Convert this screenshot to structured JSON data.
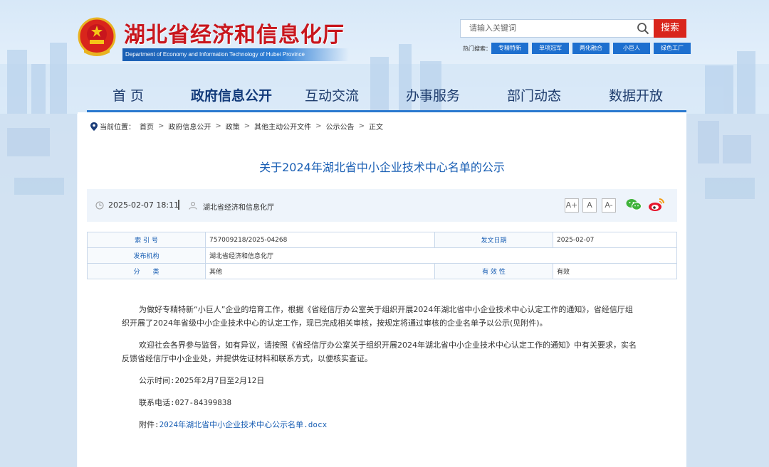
{
  "header": {
    "site_title": "湖北省经济和信息化厅",
    "site_subtitle": "Department of Economy and Information Technology of Hubei Province",
    "search_placeholder": "请输入关键词",
    "search_button": "搜索",
    "hot_label": "热门搜索：",
    "hot_tags": [
      "专精特新",
      "单项冠军",
      "两化融合",
      "小巨人",
      "绿色工厂"
    ]
  },
  "nav": {
    "items": [
      "首 页",
      "政府信息公开",
      "互动交流",
      "办事服务",
      "部门动态",
      "数据开放"
    ],
    "active_index": 1
  },
  "breadcrumb": {
    "label": "当前位置：",
    "items": [
      "首页",
      "政府信息公开",
      "政策",
      "其他主动公开文件",
      "公示公告",
      "正文"
    ],
    "separator": ">"
  },
  "article": {
    "title": "关于2024年湖北省中小企业技术中心名单的公示",
    "date": "2025-02-07 18:11",
    "source": "湖北省经济和信息化厅",
    "font_sizes": [
      "A+",
      "A",
      "A-"
    ]
  },
  "meta_table": {
    "index_label": "索 引 号",
    "index_value": "757009218/2025-04268",
    "date_label": "发文日期",
    "date_value": "2025-02-07",
    "org_label": "发布机构",
    "org_value": "湖北省经济和信息化厅",
    "category_label": "分　　类",
    "category_value": "其他",
    "validity_label": "有 效 性",
    "validity_value": "有效"
  },
  "body": {
    "p1": "为做好专精特新“小巨人”企业的培育工作，根据《省经信厅办公室关于组织开展2024年湖北省中小企业技术中心认定工作的通知》，省经信厅组织开展了2024年省级中小企业技术中心的认定工作，现已完成相关审核，按规定将通过审核的企业名单予以公示(见附件)。",
    "p2": "欢迎社会各界参与监督，如有异议，请按照《省经信厅办公室关于组织开展2024年湖北省中小企业技术中心认定工作的通知》中有关要求，实名反馈省经信厅中小企业处，并提供佐证材料和联系方式，以便核实查证。",
    "period": "公示时间:2025年2月7日至2月12日",
    "phone": "联系电话:027-84399838",
    "attachment_label": "附件:",
    "attachment_link": "2024年湖北省中小企业技术中心公示名单.docx"
  },
  "colors": {
    "brand_red": "#c8161d",
    "nav_blue": "#2a79cf",
    "link_blue": "#1a5fb4"
  }
}
